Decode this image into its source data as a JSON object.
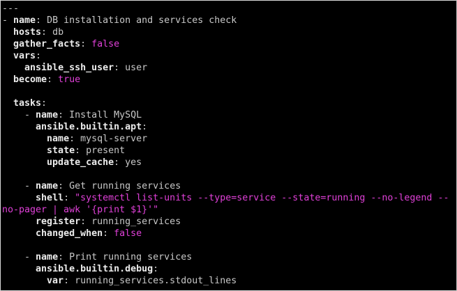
{
  "editor": {
    "doc_start": "---",
    "play": {
      "name_key": "name",
      "name_value": "DB installation and services check",
      "hosts_key": "hosts",
      "hosts_value": "db",
      "gather_facts_key": "gather_facts",
      "gather_facts_value": "false",
      "vars_key": "vars",
      "ansible_ssh_user_key": "ansible_ssh_user",
      "ansible_ssh_user_value": "user",
      "become_key": "become",
      "become_value": "true",
      "tasks_key": "tasks"
    },
    "task1": {
      "name_key": "name",
      "name_value": "Install MySQL",
      "module_key": "ansible.builtin.apt",
      "pkg_name_key": "name",
      "pkg_name_value": "mysql-server",
      "state_key": "state",
      "state_value": "present",
      "update_cache_key": "update_cache",
      "update_cache_value": "yes"
    },
    "task2": {
      "name_key": "name",
      "name_value": "Get running services",
      "shell_key": "shell",
      "shell_value_line1": "\"systemctl list-units --type=service --state=running --no-legend --",
      "shell_value_line2": "no-pager | awk '{print $1}'\"",
      "register_key": "register",
      "register_value": "running_services",
      "changed_when_key": "changed_when",
      "changed_when_value": "false"
    },
    "task3": {
      "name_key": "name",
      "name_value": "Print running services",
      "module_key": "ansible.builtin.debug",
      "var_key": "var",
      "var_value": "running_services.stdout_lines"
    },
    "colors": {
      "background": "#000000",
      "key": "#ececec",
      "value": "#c8c8c8",
      "boolean_string": "#e040d8"
    }
  }
}
